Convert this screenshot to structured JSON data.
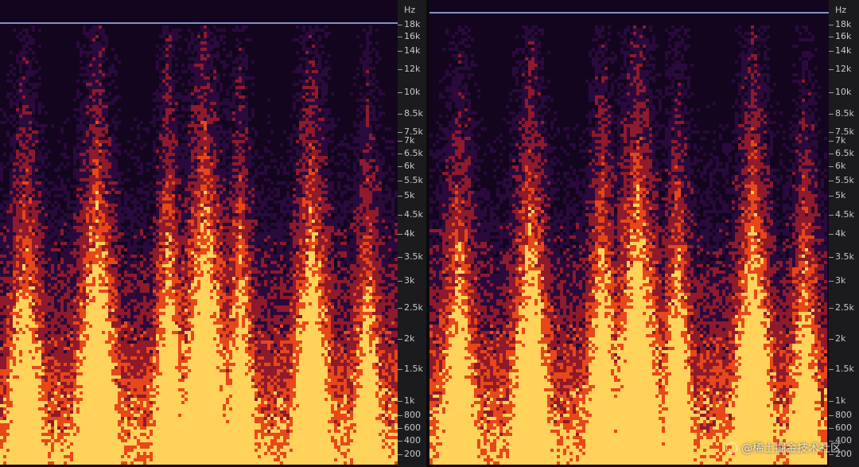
{
  "axis": {
    "unit": "Hz",
    "ticks": [
      "18k",
      "16k",
      "14k",
      "12k",
      "10k",
      "8.5k",
      "7.5k",
      "7k",
      "6.5k",
      "6k",
      "5.5k",
      "5k",
      "4.5k",
      "4k",
      "3.5k",
      "3k",
      "2.5k",
      "2k",
      "1.5k",
      "1k",
      "800",
      "600",
      "400",
      "200"
    ]
  },
  "panels": [
    {
      "name": "left-spectrogram"
    },
    {
      "name": "right-spectrogram"
    }
  ],
  "colors": {
    "background": "#14051f",
    "low": "#2a0a3c",
    "mid": "#8e1a2b",
    "high": "#e8471a",
    "peak": "#ffd25a",
    "marker_line": "#8fa3d9"
  },
  "watermark": {
    "text": "@稀土掘金技术社区"
  }
}
